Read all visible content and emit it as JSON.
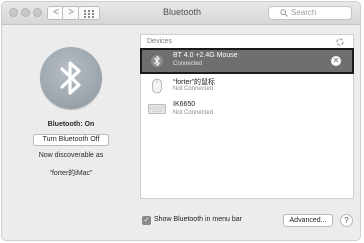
{
  "window": {
    "title": "Bluetooth",
    "search_placeholder": "Search",
    "nav_back": "<",
    "nav_forward": ">"
  },
  "status": {
    "state_label": "Bluetooth: On",
    "toggle_button": "Turn Bluetooth Off",
    "discoverable_line": "Now discoverable as",
    "device_name": "“forter的iMac”"
  },
  "devices": {
    "header": "Devices",
    "items": [
      {
        "name": "BT 4.0 +2.4G  Mouse",
        "status": "Connected",
        "icon": "bluetooth-icon",
        "selected": true
      },
      {
        "name": "“forter”的鼠标",
        "status": "Not Connected",
        "icon": "mouse-icon",
        "selected": false
      },
      {
        "name": "IK6650",
        "status": "Not Connected",
        "icon": "keyboard-icon",
        "selected": false
      }
    ]
  },
  "footer": {
    "show_in_menubar_label": "Show Bluetooth in menu bar",
    "show_in_menubar_checked": true,
    "advanced_button": "Advanced...",
    "help_button": "?"
  },
  "colors": {
    "selected_row": "#6f6f6f",
    "window_bg": "#ececec"
  }
}
